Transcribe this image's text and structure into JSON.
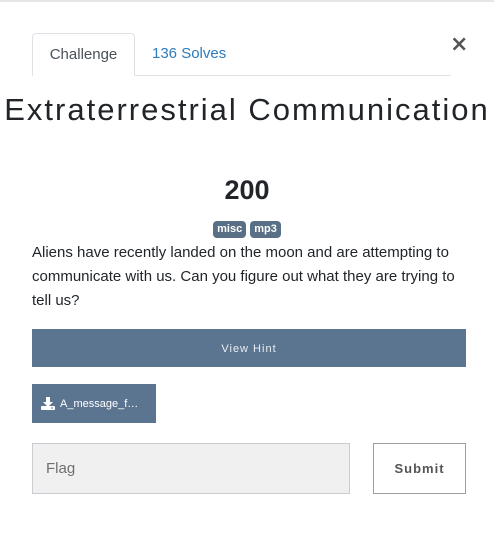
{
  "modal": {
    "close_symbol": "×",
    "tabs": [
      {
        "label": "Challenge"
      },
      {
        "label": "136 Solves"
      }
    ],
    "title": "Extraterrestrial Communication",
    "value": "200",
    "tags": [
      "misc",
      "mp3"
    ],
    "description": "Aliens have recently landed on the moon and are attempting to communicate with us. Can you figure out what they are trying to tell us?",
    "hint_label": "View Hint",
    "file_label": "A_message_f…",
    "flag_placeholder": "Flag",
    "submit_label": "Submit"
  },
  "colors": {
    "accent": "#5b7590",
    "tag_bg": "#586f86",
    "link": "#2e7bbd"
  },
  "icons": {
    "close": "close-icon",
    "download": "download-icon"
  }
}
